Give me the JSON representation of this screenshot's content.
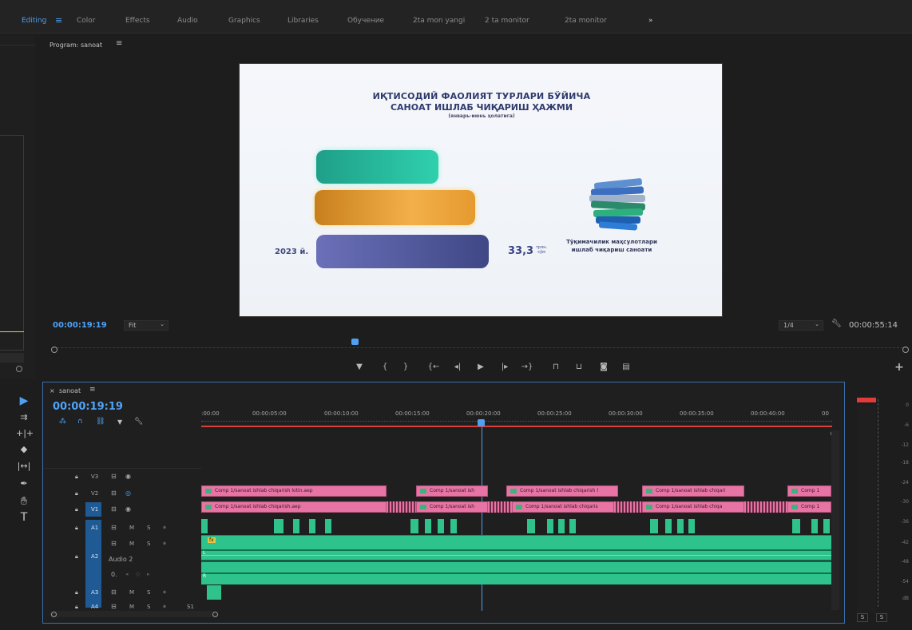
{
  "workspaces": [
    "Editing",
    "Color",
    "Effects",
    "Audio",
    "Graphics",
    "Libraries",
    "Обучение",
    "2ta mon yangi",
    "2 ta monitor",
    "2ta monitor"
  ],
  "workspace_menu_icon": "hamburger-icon",
  "workspace_more": "»",
  "program": {
    "title": "Program: sanoat",
    "timecode_current": "00:00:19:19",
    "fit_label": "Fit",
    "resolution": "1/4",
    "timecode_duration": "00:00:55:14"
  },
  "video_frame": {
    "heading_line1": "ИҚТИСОДИЙ ФАОЛИЯТ ТУРЛАРИ БЎЙИЧА",
    "heading_line2": "САНОАТ ИШЛАБ ЧИҚАРИШ ҲАЖМИ",
    "subheading": "(январь-июнь ҳолатига)",
    "year_label": "2023 й.",
    "value": "33,3",
    "unit_line1": "трлн.",
    "unit_line2": "сўм",
    "caption_line1": "Тўқимачилик маҳсулотлари",
    "caption_line2": "ишлаб чиқариш саноати",
    "bar_colors": [
      "#2fc7a5",
      "#f0a532",
      "#5b5f9f"
    ]
  },
  "timeline": {
    "sequence_tab": "sanoat",
    "timecode": "00:00:19:19",
    "ruler": [
      ":00:00",
      "00:00:05:00",
      "00:00:10:00",
      "00:00:15:00",
      "00:00:20:00",
      "00:00:25:00",
      "00:00:30:00",
      "00:00:35:00",
      "00:00:40:00",
      "00"
    ],
    "tracks": {
      "V3": "V3",
      "V2": "V2",
      "V1": "V1",
      "A1": "A1",
      "A2": "A2",
      "A2_name": "Audio 2",
      "A3": "A3",
      "A4": "A4",
      "mute": "M",
      "solo": "S",
      "master_level": "0.",
      "track_number": "S1"
    },
    "v2_clips": [
      "Comp 1/sanoat ishlab chiqarish lotin.aep",
      "Comp 1/sanoat ish",
      "Comp 1/sanoat ishlab chiqarish l",
      "Comp 1/sanoat ishlab chiqari",
      "Comp 1"
    ],
    "v1_clips": [
      "Comp 1/sanoat ishlab chiqarish.aep",
      "Comp 1/sanoat ish",
      "Comp 1/sanoat ishlab chiqaris",
      "Comp 1/sanoat ishlab chiqa",
      "Comp 1"
    ],
    "clip_marks": {
      "fx": "fx",
      "left": "L",
      "right": "R"
    }
  },
  "meters": {
    "scale": [
      "0",
      "-6",
      "-12",
      "-18",
      "-24",
      "-30",
      "-36",
      "-42",
      "-48",
      "-54",
      "dB"
    ],
    "solo_left": "S",
    "solo_right": "S",
    "peak_color": "#e23b3b"
  },
  "tool_icons": [
    "selection-tool-icon",
    "track-select-icon",
    "ripple-edit-icon",
    "razor-icon",
    "slip-icon",
    "pen-icon",
    "hand-icon",
    "type-icon"
  ]
}
